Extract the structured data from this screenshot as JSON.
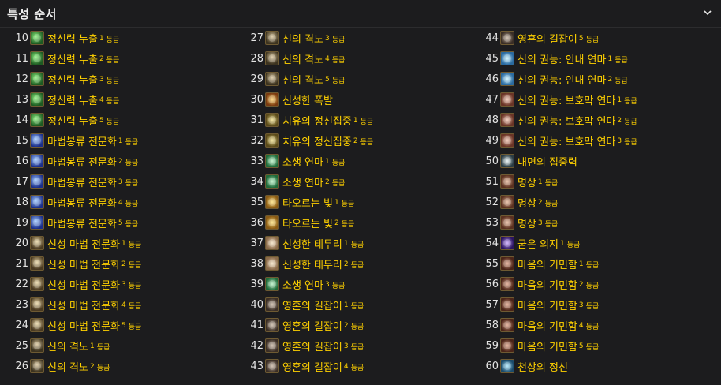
{
  "header": {
    "title": "특성 순서"
  },
  "rank_label": "등급",
  "columns": [
    [
      {
        "level": "10",
        "name": "정신력 누출",
        "rank": "1",
        "icon": "mind-leak"
      },
      {
        "level": "11",
        "name": "정신력 누출",
        "rank": "2",
        "icon": "mind-leak"
      },
      {
        "level": "12",
        "name": "정신력 누출",
        "rank": "3",
        "icon": "mind-leak"
      },
      {
        "level": "13",
        "name": "정신력 누출",
        "rank": "4",
        "icon": "mind-leak"
      },
      {
        "level": "14",
        "name": "정신력 누출",
        "rank": "5",
        "icon": "mind-leak"
      },
      {
        "level": "15",
        "name": "마법봉류 전문화",
        "rank": "1",
        "icon": "arcane-flow"
      },
      {
        "level": "16",
        "name": "마법봉류 전문화",
        "rank": "2",
        "icon": "arcane-flow"
      },
      {
        "level": "17",
        "name": "마법봉류 전문화",
        "rank": "3",
        "icon": "arcane-flow"
      },
      {
        "level": "18",
        "name": "마법봉류 전문화",
        "rank": "4",
        "icon": "arcane-flow"
      },
      {
        "level": "19",
        "name": "마법봉류 전문화",
        "rank": "5",
        "icon": "arcane-flow"
      },
      {
        "level": "20",
        "name": "신성 마법 전문화",
        "rank": "1",
        "icon": "holy-spec"
      },
      {
        "level": "21",
        "name": "신성 마법 전문화",
        "rank": "2",
        "icon": "holy-spec"
      },
      {
        "level": "22",
        "name": "신성 마법 전문화",
        "rank": "3",
        "icon": "holy-spec"
      },
      {
        "level": "23",
        "name": "신성 마법 전문화",
        "rank": "4",
        "icon": "holy-spec"
      },
      {
        "level": "24",
        "name": "신성 마법 전문화",
        "rank": "5",
        "icon": "holy-spec"
      },
      {
        "level": "25",
        "name": "신의 격노",
        "rank": "1",
        "icon": "divine-wrath"
      },
      {
        "level": "26",
        "name": "신의 격노",
        "rank": "2",
        "icon": "divine-wrath"
      }
    ],
    [
      {
        "level": "27",
        "name": "신의 격노",
        "rank": "3",
        "icon": "divine-wrath"
      },
      {
        "level": "28",
        "name": "신의 격노",
        "rank": "4",
        "icon": "divine-wrath"
      },
      {
        "level": "29",
        "name": "신의 격노",
        "rank": "5",
        "icon": "divine-wrath"
      },
      {
        "level": "30",
        "name": "신성한 폭발",
        "rank": "",
        "icon": "holy-burst"
      },
      {
        "level": "31",
        "name": "치유의 정신집중",
        "rank": "1",
        "icon": "healing-focus"
      },
      {
        "level": "32",
        "name": "치유의 정신집중",
        "rank": "2",
        "icon": "healing-focus"
      },
      {
        "level": "33",
        "name": "소생 연마",
        "rank": "1",
        "icon": "renew"
      },
      {
        "level": "34",
        "name": "소생 연마",
        "rank": "2",
        "icon": "renew"
      },
      {
        "level": "35",
        "name": "타오르는 빛",
        "rank": "1",
        "icon": "rising-light"
      },
      {
        "level": "36",
        "name": "타오르는 빛",
        "rank": "2",
        "icon": "rising-light"
      },
      {
        "level": "37",
        "name": "신성한 테두리",
        "rank": "1",
        "icon": "holy-reach"
      },
      {
        "level": "38",
        "name": "신성한 테두리",
        "rank": "2",
        "icon": "holy-reach"
      },
      {
        "level": "39",
        "name": "소생 연마",
        "rank": "3",
        "icon": "renew"
      },
      {
        "level": "40",
        "name": "영혼의 길잡이",
        "rank": "1",
        "icon": "spirit-guide"
      },
      {
        "level": "41",
        "name": "영혼의 길잡이",
        "rank": "2",
        "icon": "spirit-guide"
      },
      {
        "level": "42",
        "name": "영혼의 길잡이",
        "rank": "3",
        "icon": "spirit-guide"
      },
      {
        "level": "43",
        "name": "영혼의 길잡이",
        "rank": "4",
        "icon": "spirit-guide"
      }
    ],
    [
      {
        "level": "44",
        "name": "영혼의 길잡이",
        "rank": "5",
        "icon": "spirit-guide"
      },
      {
        "level": "45",
        "name": "신의 권능: 인내 연마",
        "rank": "1",
        "icon": "inner-focus-rank"
      },
      {
        "level": "46",
        "name": "신의 권능: 인내 연마",
        "rank": "2",
        "icon": "inner-focus-rank"
      },
      {
        "level": "47",
        "name": "신의 권능: 보호막 연마",
        "rank": "1",
        "icon": "shield-disc"
      },
      {
        "level": "48",
        "name": "신의 권능: 보호막 연마",
        "rank": "2",
        "icon": "shield-disc"
      },
      {
        "level": "49",
        "name": "신의 권능: 보호막 연마",
        "rank": "3",
        "icon": "shield-disc"
      },
      {
        "level": "50",
        "name": "내면의 집중력",
        "rank": "",
        "icon": "inner-focus"
      },
      {
        "level": "51",
        "name": "명상",
        "rank": "1",
        "icon": "meditation"
      },
      {
        "level": "52",
        "name": "명상",
        "rank": "2",
        "icon": "meditation"
      },
      {
        "level": "53",
        "name": "명상",
        "rank": "3",
        "icon": "meditation"
      },
      {
        "level": "54",
        "name": "굳은 의지",
        "rank": "1",
        "icon": "iron-will"
      },
      {
        "level": "55",
        "name": "마음의 기민함",
        "rank": "1",
        "icon": "mental-agility"
      },
      {
        "level": "56",
        "name": "마음의 기민함",
        "rank": "2",
        "icon": "mental-agility"
      },
      {
        "level": "57",
        "name": "마음의 기민함",
        "rank": "3",
        "icon": "mental-agility"
      },
      {
        "level": "58",
        "name": "마음의 기민함",
        "rank": "4",
        "icon": "mental-agility"
      },
      {
        "level": "59",
        "name": "마음의 기민함",
        "rank": "5",
        "icon": "mental-agility"
      },
      {
        "level": "60",
        "name": "천상의 정신",
        "rank": "",
        "icon": "heavenly-spirit"
      }
    ]
  ]
}
